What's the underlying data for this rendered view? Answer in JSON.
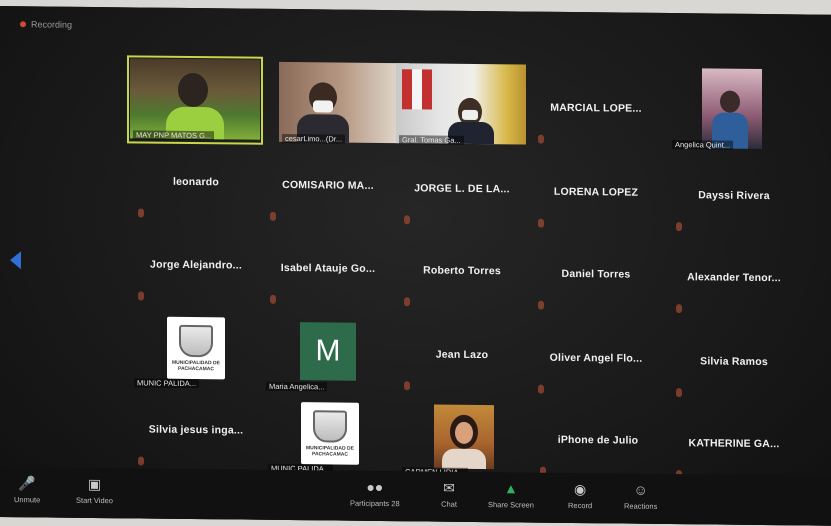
{
  "window": {
    "recording_label": "Recording"
  },
  "tiles": [
    {
      "id": "t1",
      "caption": "MAY PNP MATOS G..."
    },
    {
      "id": "t2",
      "caption": "cesarLimo...(Dr..."
    },
    {
      "id": "t3",
      "caption": "Gral. Tomas Ga..."
    },
    {
      "id": "t4",
      "name": "MARCIAL LOPE..."
    },
    {
      "id": "t5",
      "caption": "Angelica Quint..."
    },
    {
      "id": "t6",
      "name": "leonardo"
    },
    {
      "id": "t7",
      "name": "COMISARIO MA..."
    },
    {
      "id": "t8",
      "name": "JORGE L. DE LA..."
    },
    {
      "id": "t9",
      "name": "LORENA LOPEZ"
    },
    {
      "id": "t10",
      "name": "Dayssi Rivera"
    },
    {
      "id": "t11",
      "name": "Jorge Alejandro..."
    },
    {
      "id": "t12",
      "name": "Isabel Atauje Go..."
    },
    {
      "id": "t13",
      "name": "Roberto Torres"
    },
    {
      "id": "t14",
      "name": "Daniel Torres"
    },
    {
      "id": "t15",
      "name": "Alexander Tenor..."
    },
    {
      "id": "t16",
      "caption": "MUNIC PALIDA...",
      "logo_text": "MUNICIPALIDAD DE PACHACAMAC"
    },
    {
      "id": "t17",
      "caption": "Maria Angelica...",
      "avatar_letter": "M"
    },
    {
      "id": "t18",
      "name": "Jean Lazo"
    },
    {
      "id": "t19",
      "name": "Oliver Angel Flo..."
    },
    {
      "id": "t20",
      "name": "Silvia Ramos"
    },
    {
      "id": "t21",
      "name": "Silvia jesus inga..."
    },
    {
      "id": "t22",
      "caption": "MUNIC PALIDA...",
      "logo_text": "MUNICIPALIDAD DE PACHACAMAC"
    },
    {
      "id": "t23",
      "caption": "CARMEN LIDIA..."
    },
    {
      "id": "t24",
      "name": "iPhone de Julio"
    },
    {
      "id": "t25",
      "name": "KATHERINE GA..."
    }
  ],
  "toolbar": {
    "unmute": "Unmute",
    "start_video": "Start Video",
    "participants": "Participants",
    "participants_count": "28",
    "chat": "Chat",
    "share_screen": "Share Screen",
    "record": "Record",
    "reactions": "Reactions"
  },
  "colors": {
    "active_speaker": "#c8d64a",
    "share_green": "#2fb35a",
    "nav_arrow": "#2f6fd6"
  }
}
